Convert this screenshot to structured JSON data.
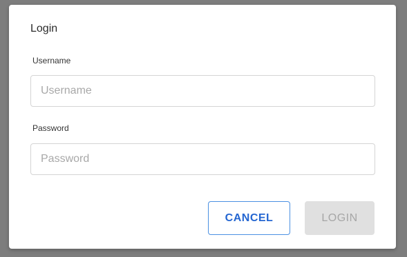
{
  "dialog": {
    "title": "Login",
    "username": {
      "label": "Username",
      "placeholder": "Username",
      "value": ""
    },
    "password": {
      "label": "Password",
      "placeholder": "Password",
      "value": ""
    },
    "buttons": {
      "cancel_label": "CANCEL",
      "login_label": "LOGIN"
    }
  },
  "colors": {
    "backdrop": "#7d7d7d",
    "accent": "#2466d1",
    "accent_border": "#4a90e2",
    "disabled_bg": "#e0e0e0",
    "disabled_text": "#a6a6a6"
  }
}
